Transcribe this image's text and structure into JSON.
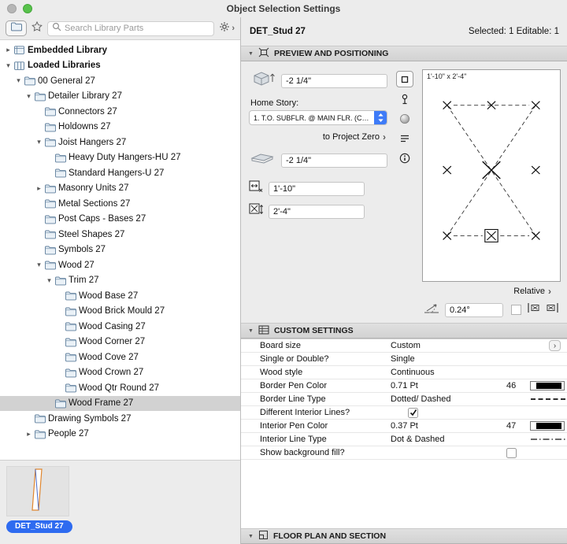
{
  "window": {
    "title": "Object Selection Settings"
  },
  "colors": {
    "accent": "#3e7bf7",
    "badge": "#2e6bf0",
    "pen_swatch": "#000000"
  },
  "library_toolbar": {
    "search_placeholder": "Search Library Parts"
  },
  "tree": {
    "items": [
      {
        "label": "Embedded Library",
        "level": 0,
        "state": "collapsed",
        "icon": "embedded-library",
        "bold": true
      },
      {
        "label": "Loaded Libraries",
        "level": 0,
        "state": "expanded",
        "icon": "loaded-libraries",
        "bold": true
      },
      {
        "label": "00 General 27",
        "level": 1,
        "state": "expanded",
        "icon": "folder"
      },
      {
        "label": "Detailer Library 27",
        "level": 2,
        "state": "expanded",
        "icon": "folder"
      },
      {
        "label": "Connectors 27",
        "level": 3,
        "icon": "folder"
      },
      {
        "label": "Holdowns 27",
        "level": 3,
        "icon": "folder"
      },
      {
        "label": "Joist Hangers 27",
        "level": 3,
        "state": "expanded",
        "icon": "folder"
      },
      {
        "label": "Heavy Duty Hangers-HU 27",
        "level": 4,
        "icon": "folder"
      },
      {
        "label": "Standard Hangers-U 27",
        "level": 4,
        "icon": "folder"
      },
      {
        "label": "Masonry Units 27",
        "level": 3,
        "state": "collapsed",
        "icon": "folder"
      },
      {
        "label": "Metal Sections 27",
        "level": 3,
        "icon": "folder"
      },
      {
        "label": "Post Caps - Bases 27",
        "level": 3,
        "icon": "folder"
      },
      {
        "label": "Steel Shapes 27",
        "level": 3,
        "icon": "folder"
      },
      {
        "label": "Symbols 27",
        "level": 3,
        "icon": "folder"
      },
      {
        "label": "Wood 27",
        "level": 3,
        "state": "expanded",
        "icon": "folder"
      },
      {
        "label": "Trim 27",
        "level": 4,
        "state": "expanded",
        "icon": "folder"
      },
      {
        "label": "Wood Base 27",
        "level": 5,
        "icon": "folder"
      },
      {
        "label": "Wood Brick Mould 27",
        "level": 5,
        "icon": "folder"
      },
      {
        "label": "Wood Casing 27",
        "level": 5,
        "icon": "folder"
      },
      {
        "label": "Wood Corner 27",
        "level": 5,
        "icon": "folder"
      },
      {
        "label": "Wood Cove 27",
        "level": 5,
        "icon": "folder"
      },
      {
        "label": "Wood Crown 27",
        "level": 5,
        "icon": "folder"
      },
      {
        "label": "Wood Qtr Round 27",
        "level": 5,
        "icon": "folder"
      },
      {
        "label": "Wood Frame 27",
        "level": 4,
        "icon": "folder",
        "selected": true
      },
      {
        "label": "Drawing Symbols 27",
        "level": 2,
        "icon": "folder"
      },
      {
        "label": "People 27",
        "level": 2,
        "state": "collapsed",
        "icon": "folder"
      }
    ]
  },
  "selected_part": {
    "name": "DET_Stud 27"
  },
  "header": {
    "object_name": "DET_Stud 27",
    "selection_status": "Selected: 1 Editable: 1"
  },
  "preview_positioning": {
    "title": "PREVIEW AND POSITIONING",
    "top_offset": "-2 1/4\"",
    "home_story_label": "Home Story:",
    "home_story_value": "1. T.O. SUBFLR. @ MAIN FLR. (C…",
    "to_project_zero_label": "to Project Zero",
    "bottom_offset": "-2 1/4\"",
    "width_value": "1'-10\"",
    "height_value": "2'-4\"",
    "preview_dimensions": "1'-10\" x 2'-4\"",
    "relative_label": "Relative",
    "rotation_angle": "0.24°"
  },
  "custom_settings": {
    "title": "CUSTOM SETTINGS",
    "rows": [
      {
        "label": "Board size",
        "value": "Custom",
        "control": "chevron"
      },
      {
        "label": "Single or Double?",
        "value": "Single"
      },
      {
        "label": "Wood style",
        "value": "Continuous"
      },
      {
        "label": "Border Pen Color",
        "value": "0.71 Pt",
        "pen_number": "46",
        "control": "swatch"
      },
      {
        "label": "Border Line Type",
        "value": "Dotted/ Dashed",
        "control": "line-dashed"
      },
      {
        "label": "Different Interior Lines?",
        "checkbox": "value",
        "checked": true
      },
      {
        "label": "Interior Pen Color",
        "value": "0.37 Pt",
        "pen_number": "47",
        "control": "swatch"
      },
      {
        "label": "Interior Line Type",
        "value": "Dot & Dashed",
        "control": "line-dashdot"
      },
      {
        "label": "Show background fill?",
        "checkbox": "pen",
        "checked": false
      }
    ]
  },
  "floor_plan_section": {
    "title": "FLOOR PLAN AND SECTION"
  }
}
